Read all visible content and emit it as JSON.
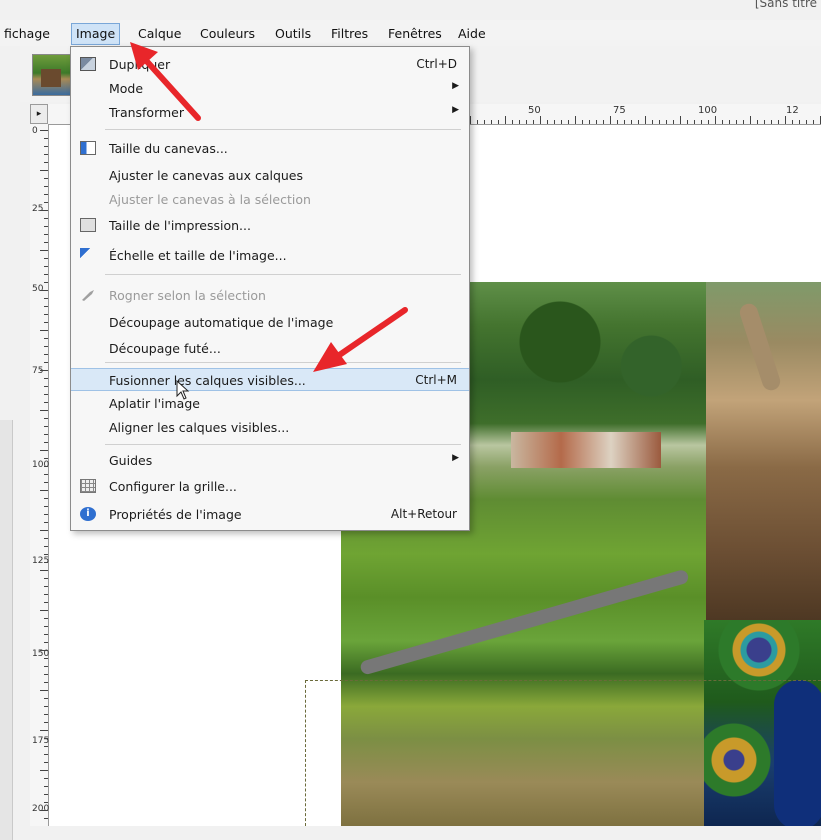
{
  "window": {
    "title_fragment": "[Sans titre"
  },
  "menubar": {
    "items": [
      "fichage",
      "Image",
      "Calque",
      "Couleurs",
      "Outils",
      "Filtres",
      "Fenêtres",
      "Aide"
    ],
    "active": "Image"
  },
  "rulers": {
    "horizontal_labels": [
      "50",
      "75",
      "100",
      "12"
    ],
    "vertical_labels": [
      "0",
      "25",
      "50",
      "75",
      "100",
      "125",
      "150",
      "175",
      "200"
    ]
  },
  "image_menu": {
    "items": [
      {
        "label": "Dupliquer",
        "shortcut": "Ctrl+D",
        "icon": "duplicate-icon"
      },
      {
        "label": "Mode",
        "submenu": true
      },
      {
        "label": "Transformer",
        "submenu": true
      },
      {
        "label": "Taille du canevas...",
        "icon": "canvas-size-icon"
      },
      {
        "label": "Ajuster le canevas aux calques"
      },
      {
        "label": "Ajuster le canevas à la sélection",
        "disabled": true
      },
      {
        "label": "Taille de l'impression...",
        "icon": "print-size-icon"
      },
      {
        "label": "Échelle et taille de l'image...",
        "icon": "scale-image-icon"
      },
      {
        "label": "Rogner selon la sélection",
        "disabled": true,
        "icon": "crop-icon"
      },
      {
        "label": "Découpage automatique de l'image"
      },
      {
        "label": "Découpage futé..."
      },
      {
        "label": "Fusionner les calques visibles...",
        "shortcut": "Ctrl+M",
        "highlighted": true
      },
      {
        "label": "Aplatir l'image"
      },
      {
        "label": "Aligner les calques visibles..."
      },
      {
        "label": "Guides",
        "submenu": true
      },
      {
        "label": "Configurer la grille...",
        "icon": "grid-icon"
      },
      {
        "label": "Propriétés de l'image",
        "shortcut": "Alt+Retour",
        "icon": "info-icon"
      }
    ]
  },
  "colors": {
    "highlight": "#d9e8f7",
    "active_menu": "#cfe3f7",
    "annotation_arrow": "#e8262a"
  }
}
